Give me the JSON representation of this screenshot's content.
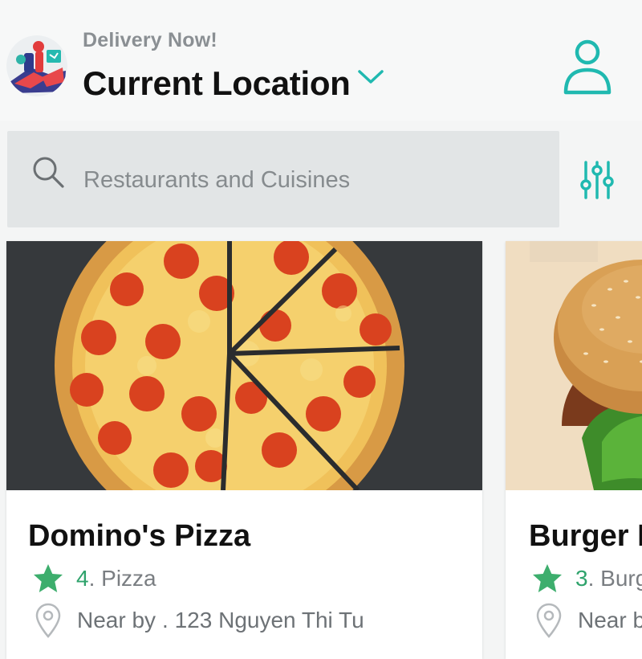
{
  "header": {
    "subtitle": "Delivery Now!",
    "location_label": "Current Location",
    "logo_icon": "delivery-scooter-logo",
    "dropdown_icon": "chevron-down-icon",
    "profile_icon": "user-icon"
  },
  "search": {
    "placeholder": "Restaurants and Cuisines",
    "icon": "search-icon",
    "filter_icon": "sliders-icon"
  },
  "colors": {
    "accent": "#20b9b0",
    "rating_green": "#2fa36c",
    "star_green": "#3dae6d"
  },
  "restaurants": [
    {
      "name": "Domino's Pizza",
      "rating": "4",
      "cuisine": ". Pizza",
      "distance_prefix": "Near by",
      "address": ". 123 Nguyen Thi Tu",
      "image": "pepperoni-pizza"
    },
    {
      "name": "Burger I",
      "rating": "3",
      "cuisine": ". Burg",
      "distance_prefix": "Near b",
      "image": "burger"
    }
  ]
}
